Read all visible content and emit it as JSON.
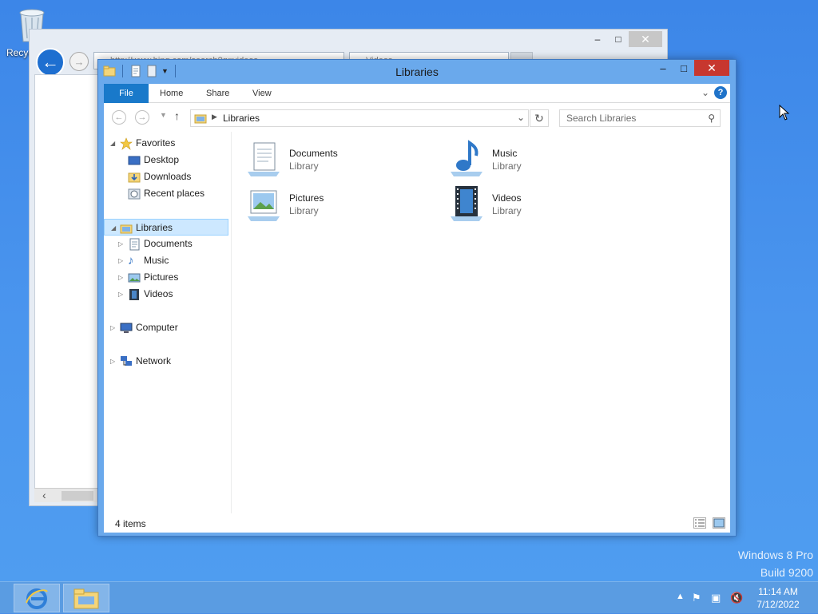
{
  "desktop": {
    "recycle_bin_label": "Recyc",
    "watermark_line1": "Windows 8 Pro",
    "watermark_line2": "Build 9200"
  },
  "background_window": {
    "address_text": "http://www.bing.com/search?q=videos",
    "tab_text": "Videos"
  },
  "explorer": {
    "title": "Libraries",
    "ribbon_tabs": [
      "File",
      "Home",
      "Share",
      "View"
    ],
    "help_label": "?",
    "address_path": "Libraries",
    "search_placeholder": "Search Libraries",
    "nav": {
      "favorites": "Favorites",
      "desktop": "Desktop",
      "downloads": "Downloads",
      "recent_places": "Recent places",
      "libraries": "Libraries",
      "documents": "Documents",
      "music": "Music",
      "pictures": "Pictures",
      "videos": "Videos",
      "computer": "Computer",
      "network": "Network"
    },
    "libraries": [
      {
        "name": "Documents",
        "type": "Library"
      },
      {
        "name": "Music",
        "type": "Library"
      },
      {
        "name": "Pictures",
        "type": "Library"
      },
      {
        "name": "Videos",
        "type": "Library"
      }
    ],
    "status_count": "4 items"
  },
  "taskbar": {
    "time": "11:14 AM",
    "date": "7/12/2022"
  },
  "colors": {
    "accent": "#1979ca",
    "window_frame": "#6aa9ec",
    "close_button": "#c7372f",
    "selection": "#cde8ff"
  }
}
